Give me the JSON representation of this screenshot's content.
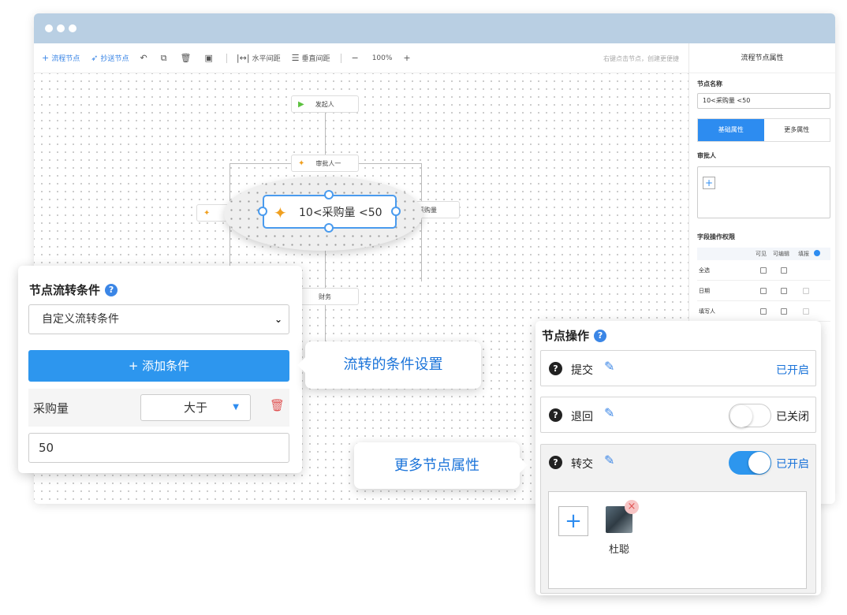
{
  "toolbar": {
    "flow_node": "流程节点",
    "cc_node": "抄送节点",
    "h_spacing": "水平间距",
    "v_spacing": "垂直间距",
    "zoom": "100%",
    "hint": "右键点击节点，创建更便捷"
  },
  "canvas": {
    "start_node": "发起人",
    "approver_node": "审批人一",
    "left_node": "",
    "right_node_suffix": "采购量",
    "finance_node": "财务",
    "zoom_node": "10<采购量 <50"
  },
  "right_panel": {
    "title": "流程节点属性",
    "node_name_label": "节点名称",
    "node_name_value": "10<采购量 <50",
    "tab_basic": "基础属性",
    "tab_more": "更多属性",
    "approver_label": "审批人",
    "perm_label": "字段操作权限",
    "perm_headers": [
      "可见",
      "可编辑",
      "填报"
    ],
    "perm_rows": [
      "全选",
      "日期",
      "填写人"
    ]
  },
  "condition_card": {
    "title": "节点流转条件",
    "select_value": "自定义流转条件",
    "add_button": "+ 添加条件",
    "field": "采购量",
    "operator": "大于",
    "value": "50"
  },
  "bubbles": {
    "condition_setting": "流转的条件设置",
    "more_props": "更多节点属性"
  },
  "ops_card": {
    "title": "节点操作",
    "ops": [
      {
        "label": "提交",
        "state": "已开启"
      },
      {
        "label": "退回",
        "state": "已关闭"
      },
      {
        "label": "转交",
        "state": "已开启"
      }
    ],
    "user_name": "杜聪"
  },
  "colors": {
    "accent": "#2d96ee",
    "titlebar": "#b9cfe3"
  }
}
